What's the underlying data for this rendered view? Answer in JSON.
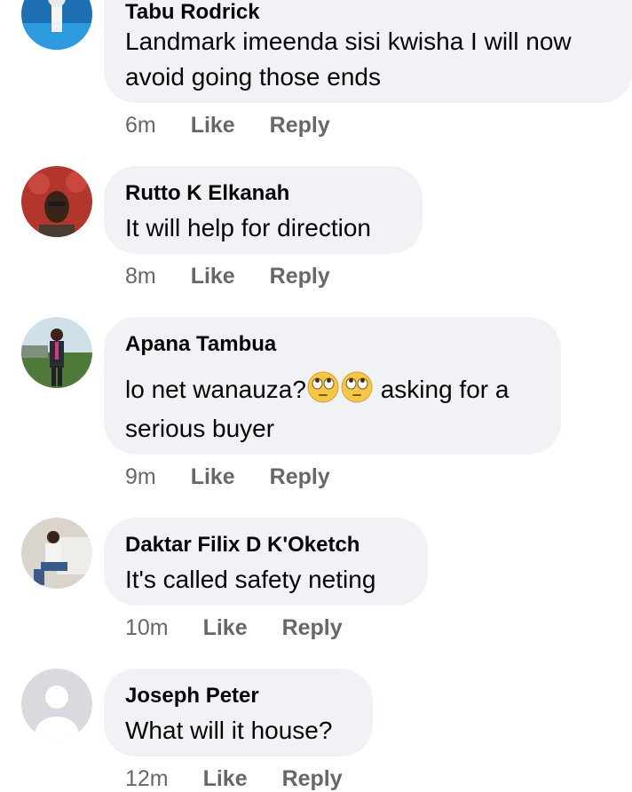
{
  "comments": [
    {
      "author": "Tabu Rodrick",
      "lines": [
        "Landmark imeenda sisi kwisha I will now",
        "avoid going those ends"
      ],
      "time": "6m",
      "like": "Like",
      "reply": "Reply"
    },
    {
      "author": "Rutto K Elkanah",
      "lines": [
        "It will help for direction"
      ],
      "time": "8m",
      "like": "Like",
      "reply": "Reply"
    },
    {
      "author": "Apana Tambua",
      "line1_before": "lo net wanauza?",
      "line1_after": " asking for a",
      "line2": "serious buyer",
      "emoji": "face-with-rolling-eyes",
      "time": "9m",
      "like": "Like",
      "reply": "Reply"
    },
    {
      "author": "Daktar Filix D K'Oketch",
      "lines": [
        "It's called safety neting"
      ],
      "time": "10m",
      "like": "Like",
      "reply": "Reply"
    },
    {
      "author": "Joseph Peter",
      "lines": [
        "What will it house?"
      ],
      "time": "12m",
      "like": "Like",
      "reply": "Reply"
    }
  ],
  "colors": {
    "bubble": "#f0f2f5",
    "meta_text": "#65676b",
    "text": "#050505"
  }
}
